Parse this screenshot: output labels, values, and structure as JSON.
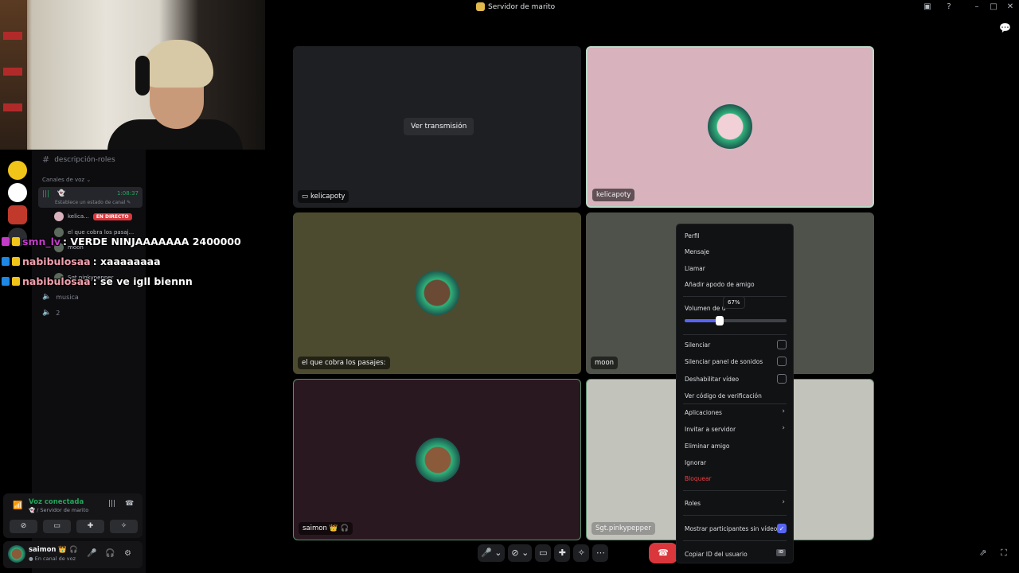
{
  "window": {
    "title": "Servidor de marito"
  },
  "sidebar": {
    "text_channel": "descripción-roles",
    "voice_category": "Canales de voz",
    "active_voice_channel": {
      "icon": "ghost-icon",
      "timer": "1:08:37",
      "status_hint": "Establece un estado de canal"
    },
    "voice_users": [
      {
        "name": "kelica...",
        "badge": "EN DIRECTO"
      },
      {
        "name": "el que cobra los pasaj..."
      },
      {
        "name": "moon"
      },
      {
        "name": "Sgt.pinkypepper"
      }
    ],
    "voice_channels": [
      "musica",
      "2"
    ]
  },
  "chat": [
    {
      "user": "smn_lv",
      "message": ": VERDE NINJAAAAAAA 2400000",
      "color": "#c23cc8"
    },
    {
      "user": "nabibulosaa",
      "message": ": xaaaaaaaa",
      "color": "#f2a0ae"
    },
    {
      "user": "nabibulosaa",
      "message": ": se ve igll biennn",
      "color": "#f2a0ae"
    }
  ],
  "voice_panel": {
    "title": "Voz conectada",
    "subtitle": "/ Servidor de marito"
  },
  "user_bar": {
    "name": "saimon",
    "status": "En canal de voz"
  },
  "stage": {
    "ver_transmision": "Ver transmisión",
    "tiles": [
      {
        "label": "kelicapoty",
        "bg": "#1e1f22",
        "kind": "stream"
      },
      {
        "label": "kelicapoty",
        "bg": "#d8b2bd",
        "kind": "avatar",
        "speaking": true
      },
      {
        "label": "el que cobra los pasajes:",
        "bg": "#4d4b2f",
        "kind": "avatar"
      },
      {
        "label": "moon",
        "bg": "#4f524a",
        "kind": "avatar"
      },
      {
        "label": "saimon",
        "bg": "#2a1820",
        "kind": "avatar",
        "speaking": true
      },
      {
        "label": "Sgt.pinkypepper",
        "bg": "#c2c4bb",
        "kind": "avatar"
      }
    ]
  },
  "context_menu": {
    "items_top": [
      "Perfil",
      "Mensaje",
      "Llamar",
      "Añadir apodo de amigo"
    ],
    "volume_label": "Volumen de u",
    "volume_value": "67%",
    "volume_fraction": 0.34,
    "toggles": [
      {
        "label": "Silenciar",
        "checked": false
      },
      {
        "label": "Silenciar panel de sonidos",
        "checked": false
      },
      {
        "label": "Deshabilitar vídeo",
        "checked": false
      }
    ],
    "verify": "Ver código de verificación",
    "apps": "Aplicaciones",
    "invite": "Invitar a servidor",
    "remove_friend": "Eliminar amigo",
    "ignore": "Ignorar",
    "block": "Bloquear",
    "roles": "Roles",
    "show_no_video": "Mostrar participantes sin vídeo",
    "copy_id": "Copiar ID del usuario",
    "id_badge": "ID"
  },
  "colors": {
    "accent": "#5865f2",
    "green": "#23a55a",
    "danger": "#f23f43"
  }
}
